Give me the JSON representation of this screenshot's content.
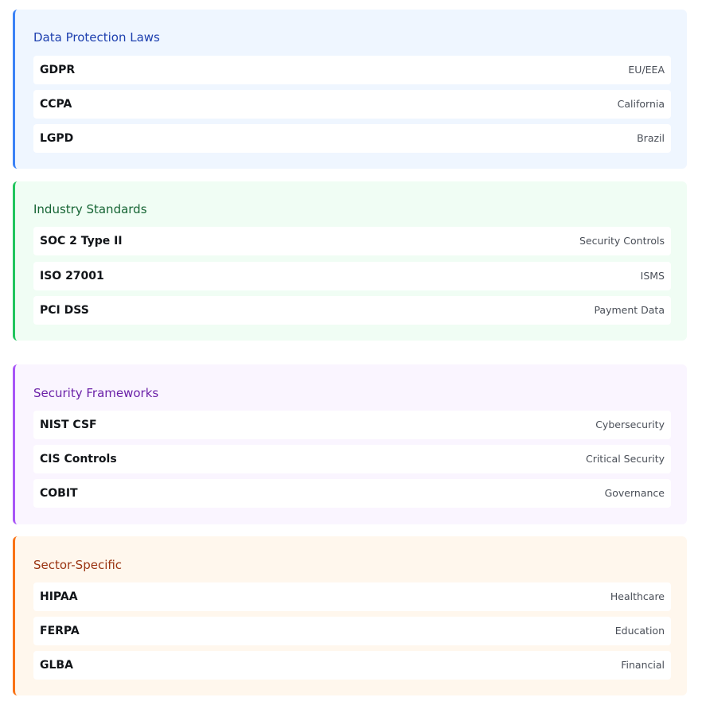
{
  "sections": [
    {
      "title": "Data Protection Laws",
      "accent": "#3b82f6",
      "background": "#eff6ff",
      "title_color": "#1e40af",
      "items": [
        {
          "name": "GDPR",
          "description": "EU/EEA"
        },
        {
          "name": "CCPA",
          "description": "California"
        },
        {
          "name": "LGPD",
          "description": "Brazil"
        }
      ]
    },
    {
      "title": "Industry Standards",
      "accent": "#22c55e",
      "background": "#f0fdf4",
      "title_color": "#166534",
      "items": [
        {
          "name": "SOC 2 Type II",
          "description": "Security Controls"
        },
        {
          "name": "ISO 27001",
          "description": "ISMS"
        },
        {
          "name": "PCI DSS",
          "description": "Payment Data"
        }
      ]
    },
    {
      "title": "Security Frameworks",
      "accent": "#a855f7",
      "background": "#faf5ff",
      "title_color": "#6b21a8",
      "items": [
        {
          "name": "NIST CSF",
          "description": "Cybersecurity"
        },
        {
          "name": "CIS Controls",
          "description": "Critical Security"
        },
        {
          "name": "COBIT",
          "description": "Governance"
        }
      ]
    },
    {
      "title": "Sector-Specific",
      "accent": "#f97316",
      "background": "#fff7ed",
      "title_color": "#9a3412",
      "items": [
        {
          "name": "HIPAA",
          "description": "Healthcare"
        },
        {
          "name": "FERPA",
          "description": "Education"
        },
        {
          "name": "GLBA",
          "description": "Financial"
        }
      ]
    }
  ]
}
